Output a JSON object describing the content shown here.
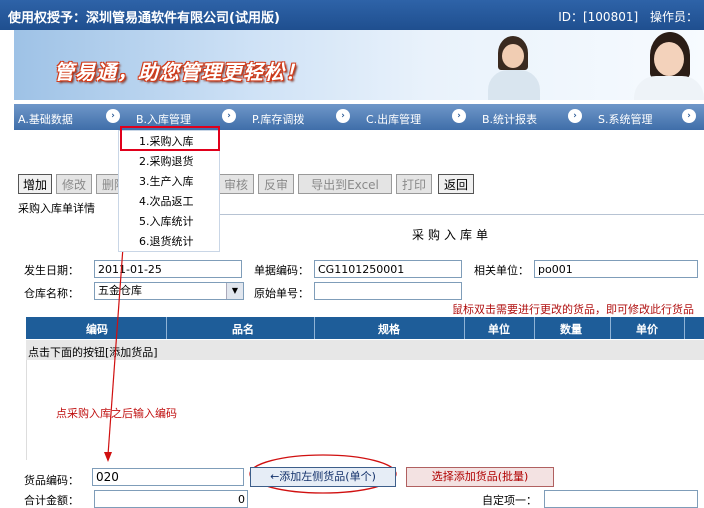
{
  "header": {
    "licensee": "使用权授予：深圳管易通软件有限公司(试用版)",
    "id_label": "ID：[100801]",
    "operator_label": "操作员："
  },
  "banner": {
    "slogan": "管易通，助您管理更轻松！"
  },
  "nav": {
    "items": [
      {
        "label": "A.基础数据"
      },
      {
        "label": "B.入库管理"
      },
      {
        "label": "P.库存调拨"
      },
      {
        "label": "C.出库管理"
      },
      {
        "label": "B.统计报表"
      },
      {
        "label": "S.系统管理"
      }
    ]
  },
  "dropdown": {
    "items": [
      "1.采购入库",
      "2.采购退货",
      "3.生产入库",
      "4.次品返工",
      "5.入库统计",
      "6.退货统计"
    ]
  },
  "toolbar": {
    "add": "增加",
    "edit": "修改",
    "delete": "删除",
    "save": "存",
    "checkdate": "期",
    "approve": "审核",
    "unapprove": "反审",
    "export": "导出到Excel",
    "print": "打印",
    "back": "返回"
  },
  "panel": {
    "tab_label": "采购入库单详情",
    "form_title": "采购入库单"
  },
  "form": {
    "date_label": "发生日期：",
    "date_value": "2011-01-25",
    "code_label": "单据编码：",
    "code_value": "CG1101250001",
    "unit_label": "相关单位：",
    "unit_value": "po001",
    "warehouse_label": "仓库名称：",
    "warehouse_value": "五金仓库",
    "orig_label": "原始单号：",
    "orig_value": ""
  },
  "hint": "鼠标双击需要进行更改的货品，即可修改此行货品",
  "grid": {
    "columns": [
      "编码",
      "品名",
      "规格",
      "单位",
      "数量",
      "单价"
    ],
    "prompt": "点击下面的按钮[添加货品]"
  },
  "annotation": "点采购入库之后输入编码",
  "bottom": {
    "goods_code_label": "货品编码：",
    "goods_code_value": "020",
    "add_left_button": "←添加左侧货品(单个)",
    "batch_add_button": "选择添加货品(批量)",
    "total_label": "合计金额：",
    "total_value": "0",
    "custom_label": "自定项一："
  },
  "colors": {
    "nav_bg": "#4a78b3",
    "grid_header": "#1e5d99",
    "highlight": "#e0001b",
    "annotation": "#c01010"
  }
}
